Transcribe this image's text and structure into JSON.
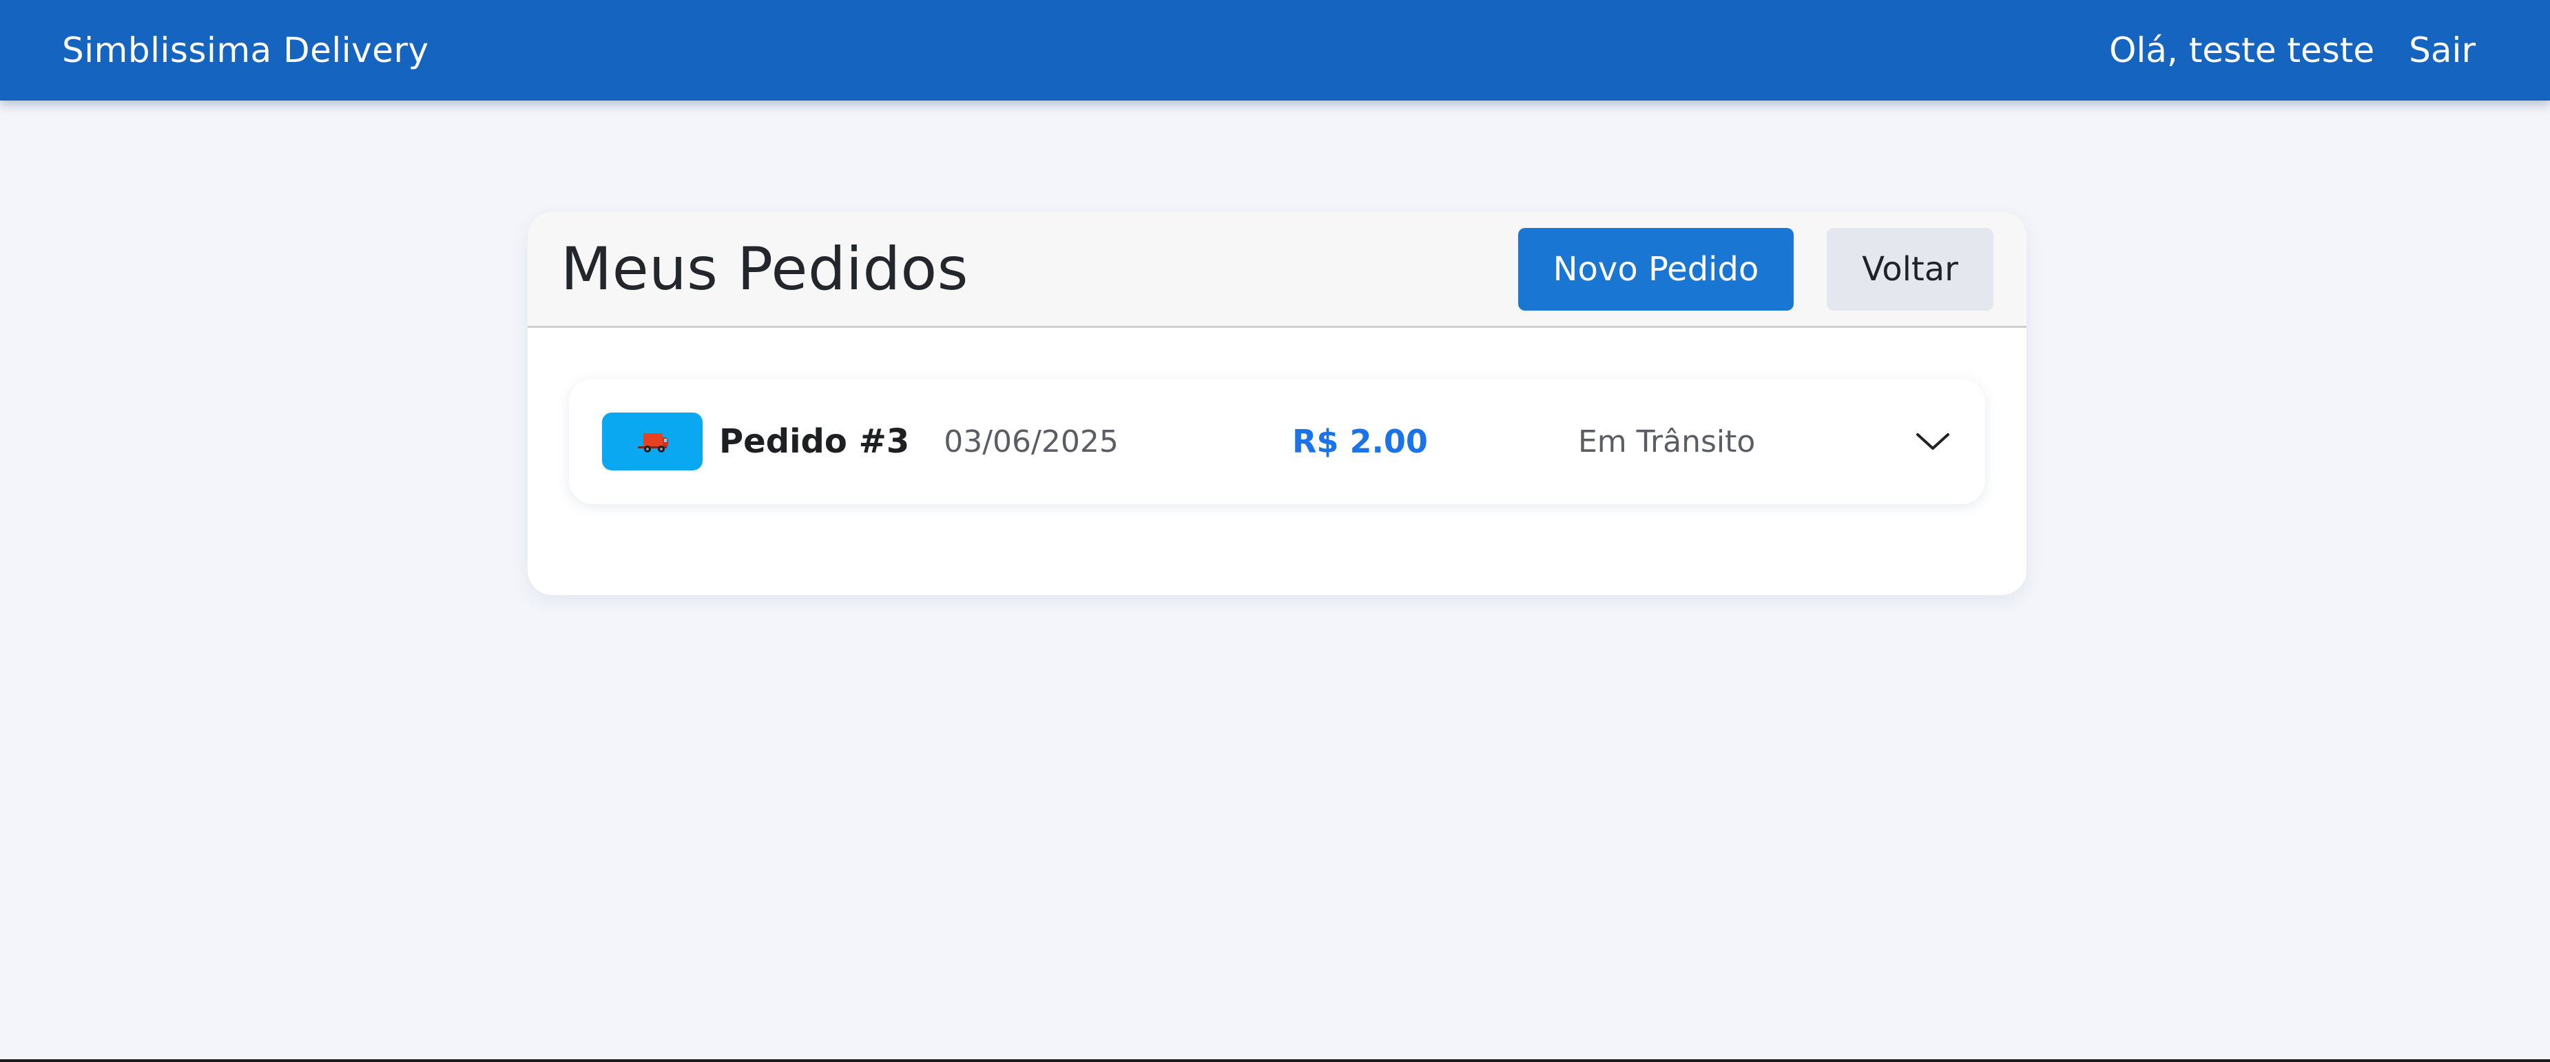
{
  "navbar": {
    "brand": "Simblissima Delivery",
    "greeting": "Olá, teste teste",
    "logout_label": "Sair",
    "background_color": "#1565c0"
  },
  "orders_page": {
    "title": "Meus Pedidos",
    "new_order_label": "Novo Pedido",
    "back_label": "Voltar",
    "orders": [
      {
        "icon": "delivery-truck-icon",
        "title": "Pedido #3",
        "date": "03/06/2025",
        "price": "R$ 2.00",
        "status": "Em Trânsito",
        "status_color": "#0aa8f0",
        "expand_icon": "chevron-down-icon"
      }
    ]
  },
  "colors": {
    "accent": "#1976d2",
    "price": "#1a73e8",
    "page_background": "#f3f5fa"
  }
}
